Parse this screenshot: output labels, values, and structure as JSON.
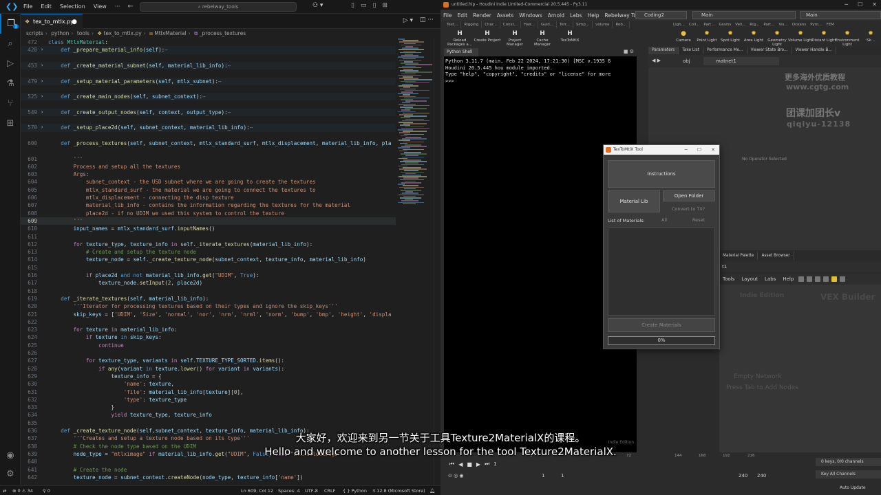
{
  "vscode": {
    "menu": [
      "File",
      "Edit",
      "Selection",
      "View"
    ],
    "search": "rebelway_tools",
    "tab": "tex_to_mtlx.py",
    "breadcrumb": [
      "scripts",
      "python",
      "tools",
      "tex_to_mtlx.py",
      "MtlxMaterial",
      "_process_textures"
    ],
    "activity_badge": "1",
    "lines": [
      {
        "n": "472",
        "html": "<span class='k'>class</span> <span class='t'>MtlxMaterial</span>:"
      },
      {
        "n": "428",
        "fold": true,
        "html": "    <span class='k'>def</span> <span class='f'>_prepare_material_info</span>(<span class='p'>self</span>):<span class='e'>⋯</span>"
      },
      {
        "n": "453",
        "fold": true,
        "html": "    <span class='k'>def</span> <span class='f'>_create_material_subnet</span>(<span class='p'>self</span>, <span class='p'>material_lib_info</span>):<span class='e'>⋯</span>"
      },
      {
        "n": "479",
        "fold": true,
        "html": "    <span class='k'>def</span> <span class='f'>_setup_material_parameters</span>(<span class='p'>self</span>, <span class='p'>mtlx_subnet</span>):<span class='e'>⋯</span>"
      },
      {
        "n": "525",
        "fold": true,
        "html": "    <span class='k'>def</span> <span class='f'>_create_main_nodes</span>(<span class='p'>self</span>, <span class='p'>subnet_context</span>):<span class='e'>⋯</span>"
      },
      {
        "n": "549",
        "fold": true,
        "html": "    <span class='k'>def</span> <span class='f'>_create_output_nodes</span>(<span class='p'>self</span>, <span class='p'>context</span>, <span class='p'>output_type</span>):<span class='e'>⋯</span>"
      },
      {
        "n": "570",
        "fold": true,
        "html": "    <span class='k'>def</span> <span class='f'>_setup_place2d</span>(<span class='p'>self</span>, <span class='p'>subnet_context</span>, <span class='p'>material_lib_info</span>):<span class='e'>⋯</span>"
      },
      {
        "n": "600",
        "html": "    <span class='k'>def</span> <span class='f'>_process_textures</span>(<span class='p'>self</span>, <span class='p'>subnet_context</span>, <span class='p'>mtlx_standard_surf</span>, <span class='p'>mtlx_displacement</span>, <span class='p'>material_lib_info</span>, <span class='p'>pla</span>"
      },
      {
        "n": "601",
        "html": "        <span class='s'>'''</span>"
      },
      {
        "n": "602",
        "html": "        <span class='s'>Process and setup all the textures</span>"
      },
      {
        "n": "603",
        "html": "        <span class='s'>Args:</span>"
      },
      {
        "n": "604",
        "html": "            <span class='s'>subnet_context - the USD subnet where we are going to create the textures</span>"
      },
      {
        "n": "605",
        "html": "            <span class='s'>mtlx_standard_surf - the material we are going to connect the textures to</span>"
      },
      {
        "n": "606",
        "html": "            <span class='s'>mtlx_displacement - connecting the disp texture</span>"
      },
      {
        "n": "607",
        "html": "            <span class='s'>material_lib_info - contains the information regarding the textures for the material</span>"
      },
      {
        "n": "608",
        "html": "            <span class='s'>place2d - if no UDIM we used this system to control the texture</span>"
      },
      {
        "n": "609",
        "cur": true,
        "html": "        <span class='s'>'''</span>"
      },
      {
        "n": "610",
        "html": "        <span class='p'>input_names</span> = <span class='p'>mtlx_standard_surf</span>.<span class='f'>inputNames</span>()"
      },
      {
        "n": "611",
        "html": ""
      },
      {
        "n": "612",
        "html": "        <span class='ctl'>for</span> <span class='p'>texture_type</span>, <span class='p'>texture_info</span> <span class='ctl'>in</span> <span class='p'>self</span>.<span class='f'>_iterate_textures</span>(<span class='p'>material_lib_info</span>):"
      },
      {
        "n": "613",
        "html": "            <span class='c'># Create and setup the texture node</span>"
      },
      {
        "n": "614",
        "html": "            <span class='p'>texture_node</span> = <span class='p'>self</span>.<span class='f'>_create_texture_node</span>(<span class='p'>subnet_context</span>, <span class='p'>texture_info</span>, <span class='p'>material_lib_info</span>)"
      },
      {
        "n": "615",
        "html": ""
      },
      {
        "n": "616",
        "html": "            <span class='ctl'>if</span> <span class='p'>place2d</span> <span class='k'>and not</span> <span class='p'>material_lib_info</span>.<span class='f'>get</span>(<span class='s'>\"UDIM\"</span>, <span class='k'>True</span>):"
      },
      {
        "n": "617",
        "html": "                <span class='p'>texture_node</span>.<span class='f'>setInput</span>(<span class='n'>2</span>, <span class='p'>place2d</span>)"
      },
      {
        "n": "618",
        "html": ""
      },
      {
        "n": "619",
        "html": "    <span class='k'>def</span> <span class='f'>_iterate_textures</span>(<span class='p'>self</span>, <span class='p'>material_lib_info</span>):"
      },
      {
        "n": "620",
        "html": "        <span class='s'>'''Iterator for processing textures based on their types and ignore the skip_keys'''</span>"
      },
      {
        "n": "621",
        "html": "        <span class='p'>skip_keys</span> = [<span class='s'>'UDIM'</span>, <span class='s'>'Size'</span>, <span class='s'>'normal'</span>, <span class='s'>'nor'</span>, <span class='s'>'nrm'</span>, <span class='s'>'nrml'</span>, <span class='s'>'norm'</span>, <span class='s'>'bump'</span>, <span class='s'>'bmp'</span>, <span class='s'>'height'</span>, <span class='s'>'displa</span>"
      },
      {
        "n": "622",
        "html": ""
      },
      {
        "n": "623",
        "html": "        <span class='ctl'>for</span> <span class='p'>texture</span> <span class='ctl'>in</span> <span class='p'>material_lib_info</span>:"
      },
      {
        "n": "624",
        "html": "            <span class='ctl'>if</span> <span class='p'>texture</span> <span class='k'>in</span> <span class='p'>skip_keys</span>:"
      },
      {
        "n": "625",
        "html": "                <span class='ctl'>continue</span>"
      },
      {
        "n": "626",
        "html": ""
      },
      {
        "n": "627",
        "html": "            <span class='ctl'>for</span> <span class='p'>texture_type</span>, <span class='p'>variants</span> <span class='ctl'>in</span> <span class='p'>self</span>.<span class='p'>TEXTURE_TYPE_SORTED</span>.<span class='f'>items</span>():"
      },
      {
        "n": "628",
        "html": "                <span class='ctl'>if</span> <span class='f'>any</span>(<span class='p'>variant</span> <span class='k'>in</span> <span class='p'>texture</span>.<span class='f'>lower</span>() <span class='ctl'>for</span> <span class='p'>variant</span> <span class='ctl'>in</span> <span class='p'>variants</span>):"
      },
      {
        "n": "629",
        "html": "                    <span class='p'>texture_info</span> = {"
      },
      {
        "n": "630",
        "html": "                        <span class='s'>'name'</span>: <span class='p'>texture</span>,"
      },
      {
        "n": "631",
        "html": "                        <span class='s'>'file'</span>: <span class='p'>material_lib_info</span>[<span class='p'>texture</span>][<span class='n'>0</span>],"
      },
      {
        "n": "632",
        "html": "                        <span class='s'>'type'</span>: <span class='p'>texture_type</span>"
      },
      {
        "n": "633",
        "html": "                    }"
      },
      {
        "n": "634",
        "html": "                    <span class='ctl'>yield</span> <span class='p'>texture_type</span>, <span class='p'>texture_info</span>"
      },
      {
        "n": "635",
        "html": ""
      },
      {
        "n": "636",
        "html": "    <span class='k'>def</span> <span class='f'>_create_texture_node</span>(<span class='p'>self</span>,<span class='p'>subnet_context</span>, <span class='p'>texture_info</span>, <span class='p'>material_lib_info</span>):"
      },
      {
        "n": "637",
        "html": "        <span class='s'>'''Creates and setup a texture node based on its type'''</span>"
      },
      {
        "n": "638",
        "html": "        <span class='c'># Check the node type based on the UDIM</span>"
      },
      {
        "n": "639",
        "html": "        <span class='p'>node_type</span> = <span class='s'>\"mtlximage\"</span> <span class='ctl'>if</span> <span class='p'>material_lib_info</span>.<span class='f'>get</span>(<span class='s'>\"UDIM\"</span>, <span class='k'>False</span>) <span class='ctl'>else</span> <span class='s'>\"mtlxtiledimage\"</span>"
      },
      {
        "n": "640",
        "html": ""
      },
      {
        "n": "641",
        "html": "        <span class='c'># Create the node</span>"
      },
      {
        "n": "642",
        "html": "        <span class='p'>texture_node</span> = <span class='p'>subnet_context</span>.<span class='f'>createNode</span>(<span class='p'>node_type</span>, <span class='p'>texture_info</span>[<span class='s'>'name'</span>])"
      }
    ],
    "status": {
      "errors": "⊗ 0 ⚠ 34",
      "ports": "⚲ 0",
      "position": "Ln 609, Col 12",
      "spaces": "Spaces: 4",
      "encoding": "UTF-8",
      "eol": "CRLF",
      "language": "{ } Python",
      "interpreter": "3.12.8 (Microsoft Store)"
    }
  },
  "houdini": {
    "title": "untitled.hip - Houdini Indie Limited-Commercial 20.5.445 - Py3.11",
    "menu": [
      "File",
      "Edit",
      "Render",
      "Assets",
      "Windows",
      "Arnold",
      "Labs",
      "Help",
      "Rebelway Tools"
    ],
    "desktop": "Coding2",
    "main1": "Main",
    "main2": "Main",
    "shelf_tabs_left": [
      "Text...",
      "Rigging",
      "Char...",
      "Const...",
      "Hair...",
      "Guid...",
      "Terr...",
      "Simp...",
      "volume",
      "Reb..."
    ],
    "shelf_tabs_right": [
      "Ligh...",
      "Coll...",
      "Part...",
      "Grains",
      "Vell...",
      "Rig...",
      "Part...",
      "Vis...",
      "Oceans",
      "Pyro...",
      "FEM"
    ],
    "tools_left": [
      {
        "icon": "H",
        "label": "Reload Packages a..."
      },
      {
        "icon": "H",
        "label": "Create Project"
      },
      {
        "icon": "H",
        "label": "Project Manager"
      },
      {
        "icon": "H",
        "label": "Cache Manager"
      },
      {
        "icon": "H",
        "label": "TexToMtlX"
      }
    ],
    "tools_right": [
      {
        "icon": "●",
        "label": "Camera"
      },
      {
        "icon": "✹",
        "label": "Point Light"
      },
      {
        "icon": "✹",
        "label": "Spot Light"
      },
      {
        "icon": "✹",
        "label": "Area Light"
      },
      {
        "icon": "✹",
        "label": "Geometry Light"
      },
      {
        "icon": "✹",
        "label": "Volume Light"
      },
      {
        "icon": "✹",
        "label": "Distant Light"
      },
      {
        "icon": "✹",
        "label": "Environment Light"
      },
      {
        "icon": "✹",
        "label": "Sk..."
      }
    ],
    "python_shell_tab": "Python Shell",
    "python_output": "Python 3.11.7 (main, Feb 22 2024, 17:21:30) [MSC v.1935 6\nHoudini 20.5.445 hou module imported.\nType \"help\", \"copyright\", \"credits\" or \"license\" for more\n>>>",
    "indie_edition": "Indie Edition",
    "param_tabs": [
      "Parameters",
      "Take List",
      "Performance Mo...",
      "Viewer State Bro...",
      "Viewer Handle B..."
    ],
    "net_path_obj": "obj",
    "net_path_node": "matnet1",
    "no_operator": "No Operator Selected",
    "watermark": [
      "更多海外优质教程",
      "www.cgtg.com",
      "团课加团长v",
      "qiqiyu-12138"
    ],
    "mat_tabs": [
      "Material Palette",
      "Asset Browser"
    ],
    "mat_path": "t1",
    "net_menu": [
      "Tools",
      "Layout",
      "Labs",
      "Help"
    ],
    "net_title_left": "Indie Edition",
    "net_title_right": "VEX Builder",
    "empty_1": "Empty Network",
    "empty_2": "Press Tab to Add Nodes",
    "ruler": [
      "1",
      "72",
      "144",
      "168",
      "192",
      "216"
    ],
    "frame_current": "1",
    "frame_start": "1",
    "frame_start2": "1",
    "frame_end": "240",
    "frame_end2": "240",
    "keys": "0 keys, 0/0 channels",
    "key_all": "Key All Channels",
    "auto_update": "Auto Update"
  },
  "dialog": {
    "title": "TexToMtlX Tool",
    "instructions": "Instructions",
    "material_lib": "Material Lib",
    "open_folder": "Open Folder",
    "convert_tx": "Convert to TX?",
    "list_label": "List of Materials:",
    "all": "All",
    "reset": "Reset",
    "create": "Create Materials",
    "progress": "0%"
  },
  "subtitles": {
    "zh": "大家好，欢迎来到另一节关于工具Texture2MaterialX的课程。",
    "en": "Hello and welcome to another lesson for the tool Texture2MaterialX."
  }
}
